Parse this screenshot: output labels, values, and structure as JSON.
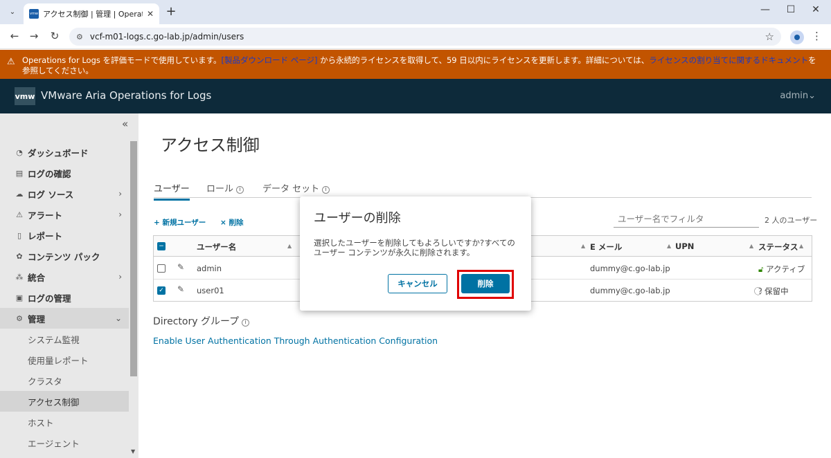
{
  "browser": {
    "tab_title": "アクセス制御 | 管理 | Operations",
    "favicon_text": "vmw",
    "url": "vcf-m01-logs.c.go-lab.jp/admin/users"
  },
  "banner": {
    "text_before": "Operations for Logs を評価モードで使用しています。",
    "link1": "[製品ダウンロード ページ]",
    "text_middle": " から永続的ライセンスを取得して、59 日以内にライセンスを更新します。詳細については、",
    "link2": "ライセンスの割り当てに関するドキュメント",
    "text_after": "を参照してください。"
  },
  "header": {
    "logo": "vmw",
    "title": "VMware Aria Operations for Logs",
    "user": "admin"
  },
  "sidebar": {
    "items": [
      {
        "label": "ダッシュボード",
        "icon": "speedometer-icon"
      },
      {
        "label": "ログの確認",
        "icon": "chart-icon"
      },
      {
        "label": "ログ ソース",
        "icon": "cloud-icon"
      },
      {
        "label": "アラート",
        "icon": "warning-icon"
      },
      {
        "label": "レポート",
        "icon": "file-icon"
      },
      {
        "label": "コンテンツ パック",
        "icon": "package-icon"
      },
      {
        "label": "統合",
        "icon": "network-icon"
      },
      {
        "label": "ログの管理",
        "icon": "log-icon"
      },
      {
        "label": "管理",
        "icon": "gear-icon"
      }
    ],
    "sub_items": [
      "システム監視",
      "使用量レポート",
      "クラスタ",
      "アクセス制御",
      "ホスト",
      "エージェント"
    ]
  },
  "main": {
    "title": "アクセス制御",
    "tabs": [
      "ユーザー",
      "ロール",
      "データ セット"
    ],
    "new_user": "+ 新規ユーザー",
    "delete": "× 削除",
    "filter_placeholder": "ユーザー名でフィルタ",
    "user_count": "2 人のユーザー",
    "columns": [
      "ユーザー名",
      "E メール",
      "UPN",
      "ステータス"
    ],
    "rows": [
      {
        "name": "admin",
        "email": "dummy@c.go-lab.jp",
        "status": "アクティブ",
        "checked": false
      },
      {
        "name": "user01",
        "email": "dummy@c.go-lab.jp",
        "status": "保留中",
        "checked": true
      }
    ],
    "directory_title": "Directory グループ",
    "directory_link": "Enable User Authentication Through Authentication Configuration"
  },
  "modal": {
    "title": "ユーザーの削除",
    "body": "選択したユーザーを削除してもよろしいですか?すべてのユーザー コンテンツが永久に削除されます。",
    "cancel": "キャンセル",
    "confirm": "削除"
  }
}
